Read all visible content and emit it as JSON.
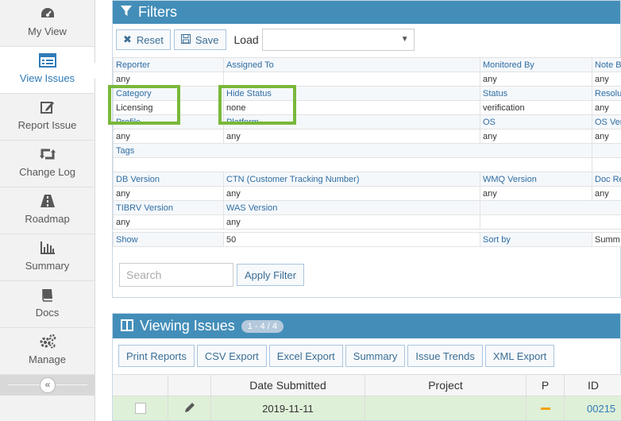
{
  "sidebar": {
    "items": [
      {
        "label": "My View",
        "icon": "dashboard-icon"
      },
      {
        "label": "View Issues",
        "icon": "list-icon"
      },
      {
        "label": "Report Issue",
        "icon": "edit-icon"
      },
      {
        "label": "Change Log",
        "icon": "retweet-icon"
      },
      {
        "label": "Roadmap",
        "icon": "road-icon"
      },
      {
        "label": "Summary",
        "icon": "bar-chart-icon"
      },
      {
        "label": "Docs",
        "icon": "book-icon"
      },
      {
        "label": "Manage",
        "icon": "gears-icon"
      }
    ],
    "collapse_symbol": "«"
  },
  "filters": {
    "title": "Filters",
    "reset_label": "Reset",
    "save_label": "Save",
    "load_label": "Load",
    "load_value": "",
    "rows": [
      {
        "labels": [
          "Reporter",
          "Assigned To",
          "Monitored By",
          "Note B"
        ],
        "values": [
          "any",
          "",
          "any",
          "any"
        ]
      },
      {
        "labels": [
          "Category",
          "Hide Status",
          "Status",
          "Resolu"
        ],
        "values": [
          "Licensing",
          "none",
          "verification",
          "any"
        ]
      },
      {
        "labels": [
          "Profile",
          "Platform",
          "OS",
          "OS Ver"
        ],
        "values": [
          "any",
          "any",
          "any",
          "any"
        ]
      },
      {
        "labels": [
          "Tags",
          "",
          "",
          ""
        ],
        "values": [
          "",
          "",
          "",
          ""
        ]
      },
      {
        "labels": [
          "DB Version",
          "CTN (Customer Tracking Number)",
          "WMQ Version",
          "Doc Re"
        ],
        "values": [
          "any",
          "any",
          "any",
          "any"
        ]
      },
      {
        "labels": [
          "TIBRV Version",
          "WAS Version",
          "",
          ""
        ],
        "values": [
          "any",
          "any",
          "",
          ""
        ]
      }
    ],
    "show_label": "Show",
    "show_value": "50",
    "sort_label": "Sort by",
    "sort_value": "Summ",
    "search_placeholder": "Search",
    "apply_label": "Apply Filter"
  },
  "issues": {
    "title": "Viewing Issues",
    "count_badge": "1 - 4 / 4",
    "buttons": [
      "Print Reports",
      "CSV Export",
      "Excel Export",
      "Summary",
      "Issue Trends",
      "XML Export"
    ],
    "columns": [
      "",
      "",
      "Date Submitted",
      "Project",
      "P",
      "ID"
    ],
    "rows": [
      {
        "date": "2019-11-11",
        "project": "",
        "id": "00215"
      }
    ]
  },
  "colors": {
    "header_blue": "#438eb9",
    "highlight_green": "#79b83a",
    "row_green": "#dff0d8",
    "priority_orange": "#f0a30a"
  }
}
